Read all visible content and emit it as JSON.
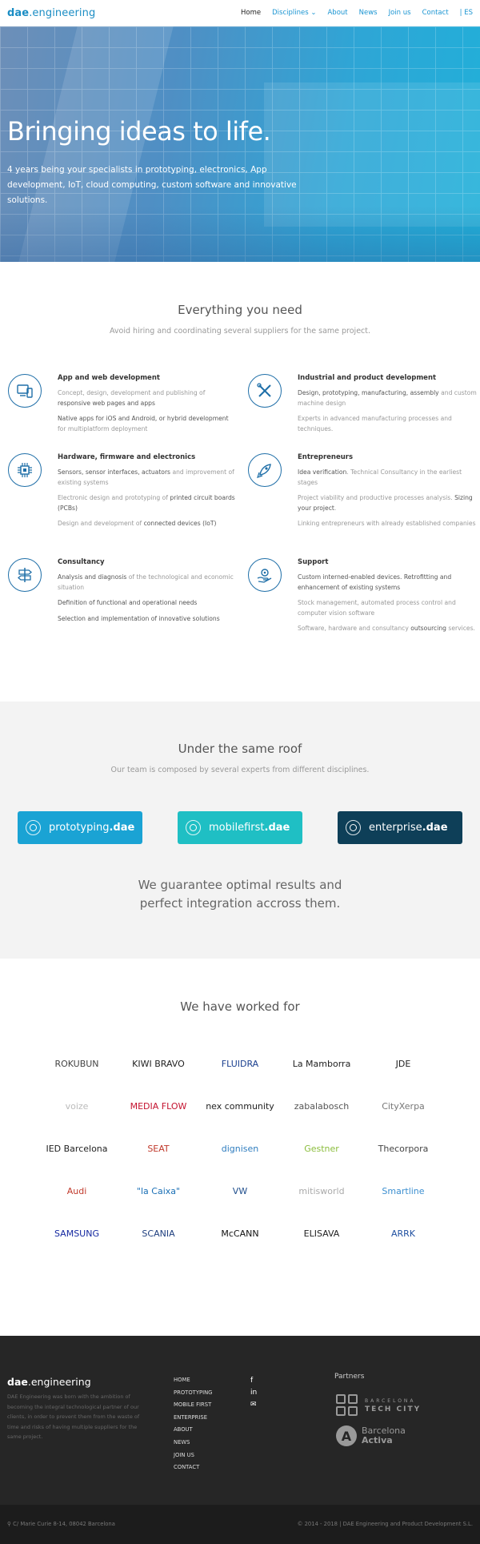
{
  "header": {
    "brand_bold": "dae",
    "brand_rest": ".engineering",
    "nav": [
      {
        "label": "Home",
        "active": true
      },
      {
        "label": "Disciplines ⌄",
        "active": false
      },
      {
        "label": "About",
        "active": false
      },
      {
        "label": "News",
        "active": false
      },
      {
        "label": "Join us",
        "active": false
      },
      {
        "label": "Contact",
        "active": false
      }
    ],
    "lang": "| ES"
  },
  "hero": {
    "title": "Bringing ideas to life.",
    "text": "4 years being your specialists in prototyping, electronics, App development, IoT, cloud computing, custom software and innovative solutions."
  },
  "everything": {
    "title": "Everything you need",
    "subtitle": "Avoid hiring and coordinating several suppliers for the same project.",
    "features": [
      {
        "title": "App and web development",
        "icon": "devices-icon",
        "items": [
          [
            "Concept, design, development and publishing of ",
            "responsive web pages and apps",
            ""
          ],
          [
            "",
            "Native apps for iOS and Android, or hybrid development",
            " for multiplatform deployment"
          ]
        ]
      },
      {
        "title": "Industrial and product development",
        "icon": "tools-icon",
        "items": [
          [
            "",
            "Design, prototyping, manufacturing, assembly",
            " and custom machine design"
          ],
          [
            "Experts in advanced manufacturing processes and techniques.",
            "",
            ""
          ]
        ]
      },
      {
        "title": "Hardware, firmware and electronics",
        "icon": "chip-icon",
        "items": [
          [
            "",
            "Sensors, sensor interfaces, actuators",
            " and improvement of existing systems"
          ],
          [
            "Electronic design and prototyping of ",
            "printed circuit boards (PCBs)",
            ""
          ],
          [
            "Design and development of ",
            "connected devices (IoT)",
            ""
          ]
        ]
      },
      {
        "title": "Entrepreneurs",
        "icon": "rocket-icon",
        "items": [
          [
            "",
            "Idea verification",
            ". Technical Consultancy in the earliest stages"
          ],
          [
            "Project viability and productive processes analysis. ",
            "Sizing your project",
            "."
          ],
          [
            "Linking entrepreneurs with already established companies",
            "",
            ""
          ]
        ]
      },
      {
        "title": "Consultancy",
        "icon": "signpost-icon",
        "items": [
          [
            "",
            "Analysis and diagnosis",
            " of the technological and economic situation"
          ],
          [
            "",
            "Definition of functional and operational needs",
            ""
          ],
          [
            "",
            "Selection and implementation of innovative solutions",
            ""
          ]
        ]
      },
      {
        "title": "Support",
        "icon": "support-gear-icon",
        "items": [
          [
            "",
            "Custom interned-enabled devices. Retrofitting and enhancement of existing systems",
            ""
          ],
          [
            "Stock management, automated process control and computer vision software",
            "",
            ""
          ],
          [
            "Software, hardware and consultancy ",
            "outsourcing",
            " services."
          ]
        ]
      }
    ]
  },
  "roof": {
    "title": "Under the same roof",
    "subtitle": "Our team is composed by several experts from different disciplines.",
    "buttons": [
      {
        "light": "prototyping",
        "bold": ".dae",
        "color": "#1aa3d4"
      },
      {
        "light": "mobilefirst",
        "bold": ".dae",
        "color": "#1fbfc4"
      },
      {
        "light": "enterprise",
        "bold": ".dae",
        "color": "#0e3f58"
      }
    ],
    "guarantee_line1": "We guarantee optimal results and",
    "guarantee_line2": "perfect integration accross them."
  },
  "worked": {
    "title": "We have worked for",
    "logos": [
      {
        "text": "ROKUBUN",
        "color": "#444"
      },
      {
        "text": "KIWI BRAVO",
        "color": "#222"
      },
      {
        "text": "FLUIDRA",
        "color": "#1a3f8f"
      },
      {
        "text": "La Mamborra",
        "color": "#222"
      },
      {
        "text": "JDE",
        "color": "#222"
      },
      {
        "text": "voize",
        "color": "#bbb"
      },
      {
        "text": "MEDIA FLOW",
        "color": "#c4122f"
      },
      {
        "text": "nex community",
        "color": "#222"
      },
      {
        "text": "zabalabosch",
        "color": "#555"
      },
      {
        "text": "CityXerpa",
        "color": "#777"
      },
      {
        "text": "IED Barcelona",
        "color": "#222"
      },
      {
        "text": "SEAT",
        "color": "#c0392b"
      },
      {
        "text": "dignisen",
        "color": "#2f7dbf"
      },
      {
        "text": "Gestner",
        "color": "#8bbd3c"
      },
      {
        "text": "Thecorpora",
        "color": "#444"
      },
      {
        "text": "Audi",
        "color": "#c0392b"
      },
      {
        "text": "\"la Caixa\"",
        "color": "#1a6fb5"
      },
      {
        "text": "VW",
        "color": "#1f4e8c"
      },
      {
        "text": "mitisworld",
        "color": "#aaa"
      },
      {
        "text": "Smartline",
        "color": "#3c8fd0"
      },
      {
        "text": "SAMSUNG",
        "color": "#1428a0"
      },
      {
        "text": "SCANIA",
        "color": "#1f3f7f"
      },
      {
        "text": "McCANN",
        "color": "#111"
      },
      {
        "text": "ELISAVA",
        "color": "#222"
      },
      {
        "text": "ARRK",
        "color": "#1f4fa0"
      }
    ]
  },
  "footer": {
    "brand_bold": "dae",
    "brand_rest": ".engineering",
    "description": "DAE Engineering was born with the ambition of becoming the integral technological partner of our clients, in order to prevent them from the waste of time and risks of having multiple suppliers for the same project.",
    "nav": [
      "HOME",
      "PROTOTYPING",
      "MOBILE FIRST",
      "ENTERPRISE",
      "ABOUT",
      "NEWS",
      "JOIN US",
      "CONTACT"
    ],
    "social": [
      "f",
      "in",
      "✉"
    ],
    "partners_title": "Partners",
    "tech_city_top": "BARCELONA",
    "tech_city_bottom": "TECH CITY",
    "activa_top": "Barcelona",
    "activa_bottom": "Activa",
    "address": "⚲ C/ Marie Curie 8-14, 08042 Barcelona",
    "copyright": "© 2014 - 2018 | DAE Engineering and Product Development S.L."
  }
}
